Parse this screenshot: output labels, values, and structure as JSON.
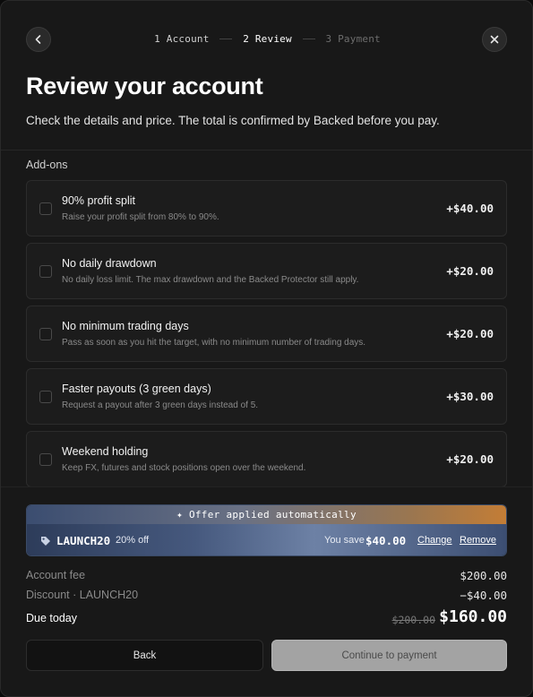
{
  "steps": [
    {
      "label": "1 Account"
    },
    {
      "label": "2 Review"
    },
    {
      "label": "3 Payment"
    }
  ],
  "header": {
    "title": "Review your account",
    "subtitle": "Check the details and price. The total is confirmed by Backed before you pay."
  },
  "addons": {
    "label": "Add-ons",
    "items": [
      {
        "name": "90% profit split",
        "desc": "Raise your profit split from 80% to 90%.",
        "price": "+$40.00",
        "checked": false
      },
      {
        "name": "No daily drawdown",
        "desc": "No daily loss limit. The max drawdown and the Backed Protector still apply.",
        "price": "+$20.00",
        "checked": false
      },
      {
        "name": "No minimum trading days",
        "desc": "Pass as soon as you hit the target, with no minimum number of trading days.",
        "price": "+$20.00",
        "checked": false
      },
      {
        "name": "Faster payouts (3 green days)",
        "desc": "Request a payout after 3 green days instead of 5.",
        "price": "+$30.00",
        "checked": false
      },
      {
        "name": "Weekend holding",
        "desc": "Keep FX, futures and stock positions open over the weekend.",
        "price": "+$20.00",
        "checked": false
      }
    ]
  },
  "offer": {
    "banner": "✦ Offer applied automatically",
    "code": "LAUNCH20",
    "percent": "20% off",
    "save_label": "You save",
    "save_amount": "$40.00",
    "change_label": "Change",
    "remove_label": "Remove"
  },
  "summary": {
    "fee_label": "Account fee",
    "fee_value": "$200.00",
    "discount_label": "Discount · LAUNCH20",
    "discount_value": "−$40.00",
    "due_label": "Due today",
    "original_total": "$200.00",
    "total": "$160.00"
  },
  "actions": {
    "back_label": "Back",
    "continue_label": "Continue to payment"
  },
  "colors": {
    "background": "#181818",
    "offer_accent": "#c37d36",
    "continue_disabled": "#a3a3a3"
  }
}
